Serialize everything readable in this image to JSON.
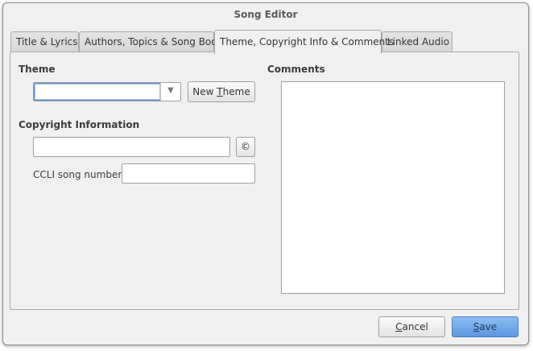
{
  "window": {
    "title": "Song Editor"
  },
  "tabs": [
    {
      "label": "Title & Lyrics",
      "active": false
    },
    {
      "label": "Authors, Topics & Song Book",
      "active": false
    },
    {
      "label": "Theme, Copyright Info & Comments",
      "active": true
    },
    {
      "label": "Linked Audio",
      "active": false
    }
  ],
  "theme": {
    "heading": "Theme",
    "selected_value": "",
    "dropdown_arrow": "▼",
    "new_theme_button": {
      "label_prefix": "New ",
      "label_mnemonic": "T",
      "label_suffix": "heme"
    }
  },
  "copyright": {
    "heading": "Copyright Information",
    "value": "",
    "copyright_button_glyph": "©",
    "ccli_label": "CCLI song number:",
    "ccli_value": ""
  },
  "comments": {
    "heading": "Comments",
    "value": ""
  },
  "footer": {
    "cancel_button": {
      "mnemonic": "C",
      "rest": "ancel"
    },
    "save_button": {
      "mnemonic": "S",
      "rest": "ave"
    }
  },
  "colors": {
    "window_bg": "#f0f0f0",
    "focus_border": "#5b8bd0",
    "primary_button": "#5c98e0"
  },
  "icons": [
    "chevron-down-icon",
    "copyright-icon"
  ]
}
